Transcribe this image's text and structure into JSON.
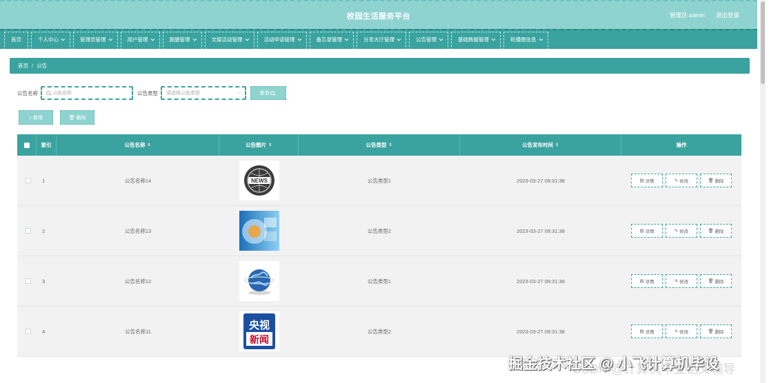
{
  "header": {
    "title": "校园生活服务平台",
    "admin": "管理员 admin",
    "logout": "退出登录"
  },
  "nav": [
    {
      "label": "首页",
      "dropdown": false
    },
    {
      "label": "个人中心",
      "dropdown": true
    },
    {
      "label": "管理员管理",
      "dropdown": true
    },
    {
      "label": "用户管理",
      "dropdown": true
    },
    {
      "label": "跑腿管理",
      "dropdown": true
    },
    {
      "label": "文娱活动管理",
      "dropdown": true
    },
    {
      "label": "活动申请管理",
      "dropdown": true
    },
    {
      "label": "备忘录管理",
      "dropdown": true
    },
    {
      "label": "分享大厅管理",
      "dropdown": true
    },
    {
      "label": "公告管理",
      "dropdown": true
    },
    {
      "label": "基础数据管理",
      "dropdown": true
    },
    {
      "label": "轮播图信息",
      "dropdown": true
    }
  ],
  "breadcrumb": {
    "home": "首页",
    "sep": "/",
    "current": "公告"
  },
  "search": {
    "name_label": "公告名称",
    "name_placeholder": "公告名称",
    "type_label": "公告类型",
    "type_placeholder": "请选择公告类型",
    "query_label": "查询"
  },
  "actions": {
    "add_label": "+ 新增",
    "delete_label": "删除"
  },
  "table": {
    "columns": {
      "index": "索引",
      "name": "公告名称",
      "image": "公告图片",
      "type": "公告类型",
      "time": "公告发布时间",
      "op": "操作"
    },
    "rows": [
      {
        "index": "1",
        "name": "公告名称14",
        "image": "news-icon-image",
        "type": "公告类型1",
        "time": "2023-03-27 09:31:38"
      },
      {
        "index": "2",
        "name": "公告名称13",
        "image": "blue-abstract-image",
        "type": "公告类型2",
        "time": "2023-03-27 09:31:38"
      },
      {
        "index": "3",
        "name": "公告名称12",
        "image": "globe-image",
        "type": "公告类型1",
        "time": "2023-03-27 09:31:38"
      },
      {
        "index": "4",
        "name": "公告名称11",
        "image": "cctv-news-logo-image",
        "type": "公告类型2",
        "time": "2023-03-27 09:31:38"
      }
    ],
    "row_buttons": {
      "detail": "详情",
      "edit": "修改",
      "delete": "删除"
    }
  },
  "watermark": {
    "main": "掘金技术社区 @ 小飞计算机毕设",
    "secondary": "CSDN @计算机毕业论文辅导"
  },
  "colors": {
    "header_bg": "#8fd3d0",
    "nav_bg": "#3aa39f",
    "row_bg": "#f2f2f2"
  }
}
